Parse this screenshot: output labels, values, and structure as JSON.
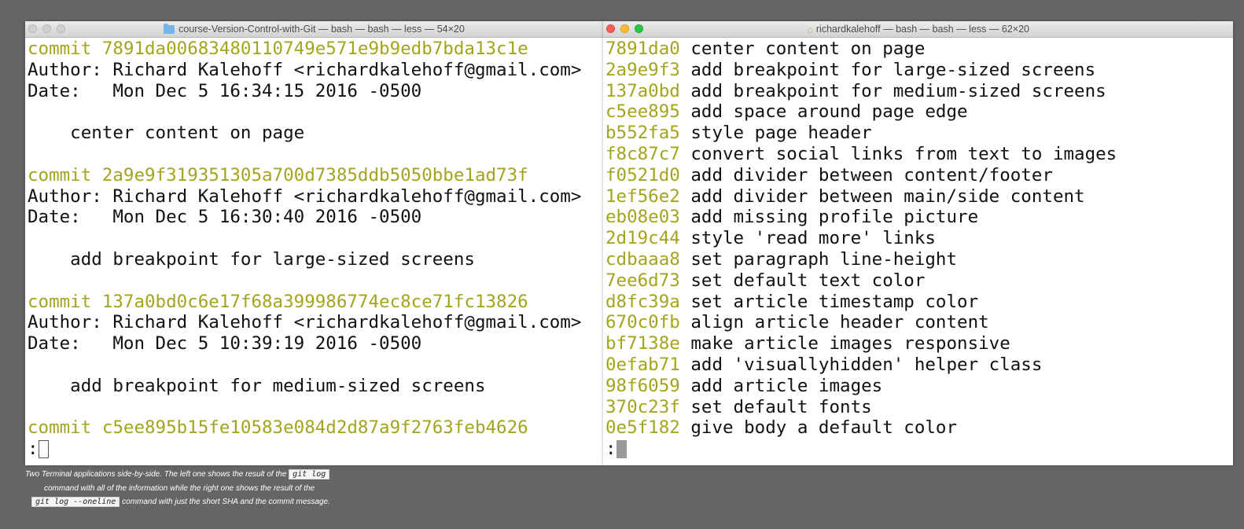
{
  "left_window": {
    "title": "course-Version-Control-with-Git — bash — bash — less — 54×20",
    "lines": [
      {
        "text": "commit 7891da00683480110749e571e9b9edb7bda13c1e",
        "commit": true
      },
      {
        "text": "Author: Richard Kalehoff <richardkalehoff@gmail.com>"
      },
      {
        "text": "Date:   Mon Dec 5 16:34:15 2016 -0500"
      },
      {
        "text": ""
      },
      {
        "text": "    center content on page"
      },
      {
        "text": ""
      },
      {
        "text": "commit 2a9e9f319351305a700d7385ddb5050bbe1ad73f",
        "commit": true
      },
      {
        "text": "Author: Richard Kalehoff <richardkalehoff@gmail.com>"
      },
      {
        "text": "Date:   Mon Dec 5 16:30:40 2016 -0500"
      },
      {
        "text": ""
      },
      {
        "text": "    add breakpoint for large-sized screens"
      },
      {
        "text": ""
      },
      {
        "text": "commit 137a0bd0c6e17f68a399986774ec8ce71fc13826",
        "commit": true
      },
      {
        "text": "Author: Richard Kalehoff <richardkalehoff@gmail.com>"
      },
      {
        "text": "Date:   Mon Dec 5 10:39:19 2016 -0500"
      },
      {
        "text": ""
      },
      {
        "text": "    add breakpoint for medium-sized screens"
      },
      {
        "text": ""
      },
      {
        "text": "commit c5ee895b15fe10583e084d2d87a9f2763feb4626",
        "commit": true
      }
    ],
    "prompt": ":"
  },
  "right_window": {
    "title": "richardkalehoff — bash — bash — less — 62×20",
    "entries": [
      {
        "sha": "7891da0",
        "msg": "center content on page"
      },
      {
        "sha": "2a9e9f3",
        "msg": "add breakpoint for large-sized screens"
      },
      {
        "sha": "137a0bd",
        "msg": "add breakpoint for medium-sized screens"
      },
      {
        "sha": "c5ee895",
        "msg": "add space around page edge"
      },
      {
        "sha": "b552fa5",
        "msg": "style page header"
      },
      {
        "sha": "f8c87c7",
        "msg": "convert social links from text to images"
      },
      {
        "sha": "f0521d0",
        "msg": "add divider between content/footer"
      },
      {
        "sha": "1ef56e2",
        "msg": "add divider between main/side content"
      },
      {
        "sha": "eb08e03",
        "msg": "add missing profile picture"
      },
      {
        "sha": "2d19c44",
        "msg": "style 'read more' links"
      },
      {
        "sha": "cdbaaa8",
        "msg": "set paragraph line-height"
      },
      {
        "sha": "7ee6d73",
        "msg": "set default text color"
      },
      {
        "sha": "d8fc39a",
        "msg": "set article timestamp color"
      },
      {
        "sha": "670c0fb",
        "msg": "align article header content"
      },
      {
        "sha": "bf7138e",
        "msg": "make article images responsive"
      },
      {
        "sha": "0efab71",
        "msg": "add 'visuallyhidden' helper class"
      },
      {
        "sha": "98f6059",
        "msg": "add article images"
      },
      {
        "sha": "370c23f",
        "msg": "set default fonts"
      },
      {
        "sha": "0e5f182",
        "msg": "give body a default color"
      }
    ],
    "prompt": ":"
  },
  "caption": {
    "part1": "Two Terminal applications side-by-side. The left one shows the result of the",
    "code1": "git log",
    "part2": "command with all of the information while the right one shows the result of the",
    "code2": "git log --oneline",
    "part3": "command with just the short SHA and the commit message."
  },
  "colors": {
    "background": "#646564",
    "commit_yellow": "#a4a41d",
    "terminal_text": "#111111"
  },
  "icons": {
    "left_title": "folder-icon",
    "right_title": "home-icon"
  }
}
